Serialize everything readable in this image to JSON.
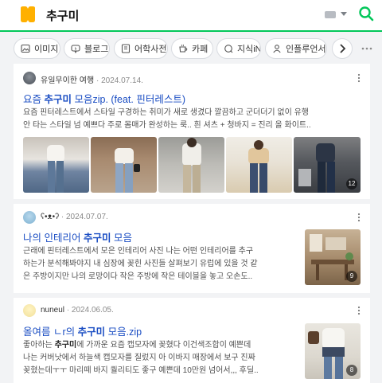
{
  "header": {
    "query": "추구미",
    "brand_color": "#ffb000",
    "accent_color": "#03c75a"
  },
  "tabs": [
    {
      "label": "이미지",
      "icon": "image-icon"
    },
    {
      "label": "블로그",
      "icon": "blog-icon"
    },
    {
      "label": "어학사전",
      "icon": "dictionary-icon"
    },
    {
      "label": "카페",
      "icon": "cafe-icon"
    },
    {
      "label": "지식iN",
      "icon": "knowledge-icon"
    },
    {
      "label": "인플루언서",
      "icon": "person-icon"
    }
  ],
  "results": [
    {
      "source": "유일무이한 여행",
      "date": "2024.07.14.",
      "title_pre": "요즘 ",
      "title_kw": "추구미",
      "title_post": " 모음zip. (feat. 핀터레스트)",
      "desc_line1": "요즘 핀터레스트에서 스타일 구경하는 취미가 새로 생겼다 깔끔하고 군더더기 없이 유행",
      "desc_line2": "안 타는 스타일 넘 예쁘다 주로 몸매가 완성하는 룩.. 흰 셔츠 + 청바지 = 진리 올 화이트..",
      "image_count": "12"
    },
    {
      "source": "ʕ•ᴥ•ʔ",
      "date": "2024.07.07.",
      "title_pre": "나의 인테리어 ",
      "title_kw": "추구미",
      "title_post": " 모음",
      "desc_line1": "근래에 핀터레스트에서 모은 인테리어 사진 나는 어떤 인테리어를 추구",
      "desc_line2": "하는가 분석해봐야지 내 심장에 꽂힌 사진들 살펴보기 유럽에 있을 것 같",
      "desc_line3": "은 주방이지만 나의 로망이다 작은 주방에 작은 테이블을 놓고 오손도..",
      "image_count": "9"
    },
    {
      "source": "nuneul",
      "date": "2024.06.05.",
      "title_pre": "올여름 ㄴr의 ",
      "title_kw": "추구미",
      "title_post": " 모음.zip",
      "desc_line1_pre": "좋아하는 ",
      "desc_line1_kw": "추구미",
      "desc_line1_post": "에 가까운 요즘 캡모자에 꽂혔다 이건색조합이 예쁜데",
      "desc_line2": "나는 커버낫에서 하늘색 캡모자를 질렀지 아 이바지 매장에서 보구 진짜",
      "desc_line3": "꽂혔는데ㅜㅜ 마리떼 바지 퀄리티도 좋구 예쁜데 10만원 넘어서,,, 후딜..",
      "image_count": "8"
    }
  ]
}
